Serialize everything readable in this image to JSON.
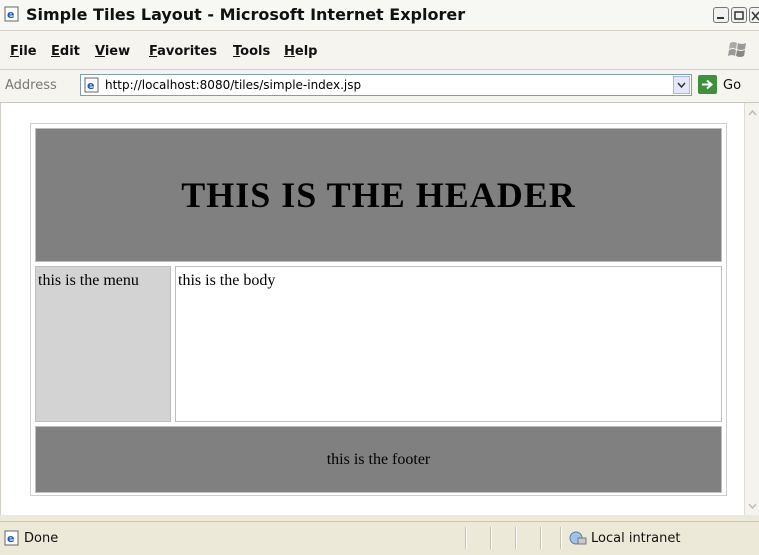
{
  "window": {
    "title": "Simple Tiles Layout - Microsoft Internet Explorer",
    "icon": "ie-page-icon"
  },
  "menubar": {
    "items": [
      "File",
      "Edit",
      "View",
      "Favorites",
      "Tools",
      "Help"
    ]
  },
  "addressbar": {
    "label": "Address",
    "url": "http://localhost:8080/tiles/simple-index.jsp",
    "go_label": "Go"
  },
  "page": {
    "header": "THIS IS THE HEADER",
    "menu": "this is the menu",
    "body": "this is the body",
    "footer": "this is the footer"
  },
  "statusbar": {
    "status": "Done",
    "zone": "Local intranet"
  },
  "colors": {
    "header_bg": "#808080",
    "menu_bg": "#d3d3d3",
    "footer_bg": "#808080"
  }
}
